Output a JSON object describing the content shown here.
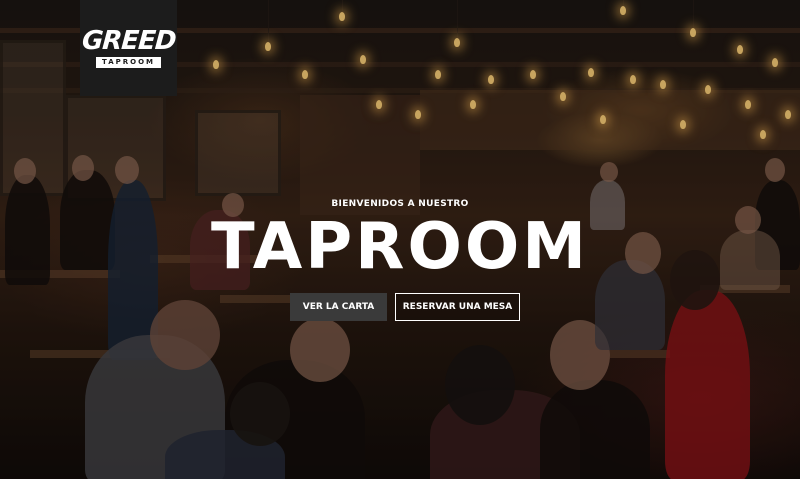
{
  "brand": {
    "logo_word": "GREED",
    "logo_sub": "TAPROOM"
  },
  "hero": {
    "welcome": "BIENVENIDOS A NUESTRO",
    "title": "TAPROOM",
    "buttons": {
      "carta_label": "VER LA CARTA",
      "reserva_label": "RESERVAR UNA MESA"
    }
  },
  "colors": {
    "logo_bg": "#1c1c1c",
    "button_dark": "#3a3a3a",
    "text": "#ffffff"
  }
}
